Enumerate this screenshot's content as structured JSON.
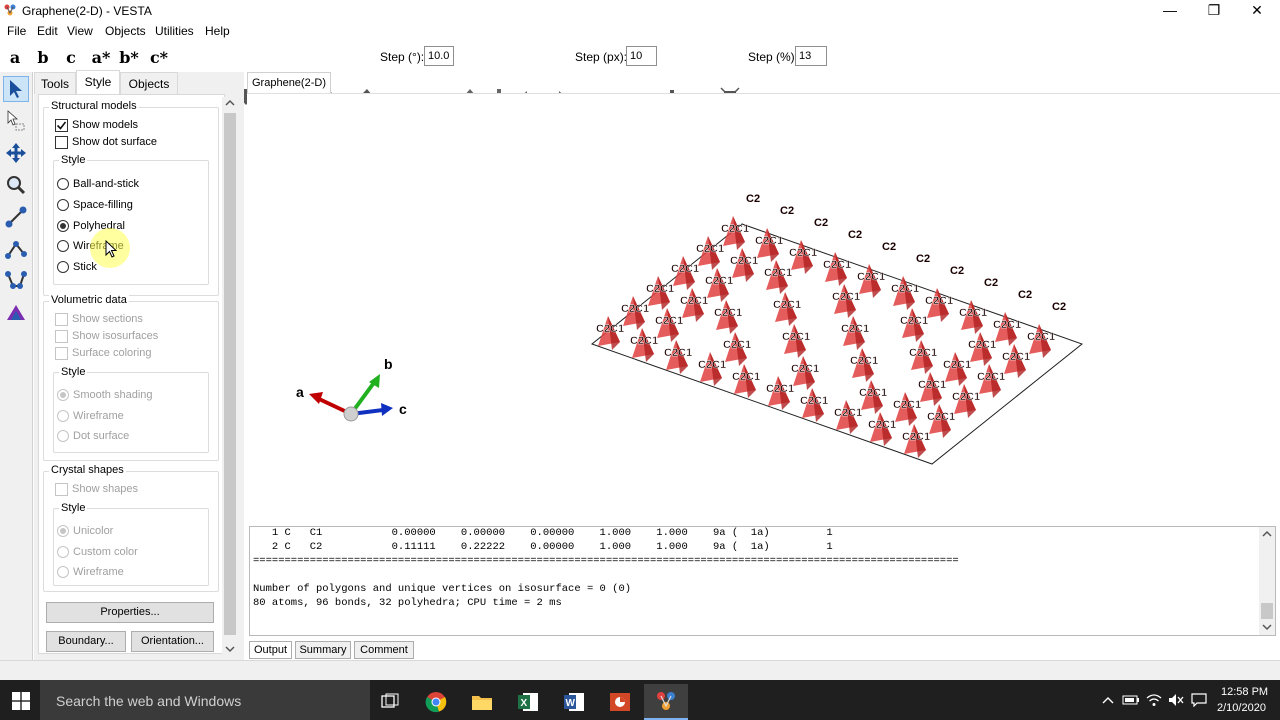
{
  "window": {
    "title": "Graphene(2-D) - VESTA",
    "minimize": "—",
    "restore": "❐",
    "close": "✕"
  },
  "menu": [
    "File",
    "Edit",
    "View",
    "Objects",
    "Utilities",
    "Help"
  ],
  "toolbar": {
    "axis_buttons": [
      "a",
      "b",
      "c",
      "a*",
      "b*",
      "c*"
    ],
    "step_deg_label": "Step (°):",
    "step_deg_value": "10.0",
    "step_px_label": "Step (px):",
    "step_px_value": "10",
    "step_pct_label": "Step (%):",
    "step_pct_value": "13"
  },
  "panel": {
    "tabs": [
      "Tools",
      "Style",
      "Objects"
    ],
    "structural": {
      "title": "Structural models",
      "show_models": "Show models",
      "show_dot_surface": "Show dot surface",
      "style_title": "Style",
      "styles": [
        "Ball-and-stick",
        "Space-filling",
        "Polyhedral",
        "Wireframe",
        "Stick"
      ],
      "selected": "Polyhedral"
    },
    "volumetric": {
      "title": "Volumetric data",
      "options": [
        "Show sections",
        "Show isosurfaces",
        "Surface coloring"
      ],
      "style_title": "Style",
      "styles": [
        "Smooth shading",
        "Wireframe",
        "Dot surface"
      ]
    },
    "crystal": {
      "title": "Crystal shapes",
      "show_shapes": "Show shapes",
      "style_title": "Style",
      "styles": [
        "Unicolor",
        "Custom color",
        "Wireframe"
      ]
    },
    "buttons": {
      "properties": "Properties...",
      "boundary": "Boundary...",
      "orientation": "Orientation..."
    }
  },
  "view_tab": "Graphene(2-D)",
  "axes": {
    "a": "a",
    "b": "b",
    "c": "c"
  },
  "atom_labels": {
    "c1": "C1",
    "c2": "C2"
  },
  "output": {
    "lines": [
      "   1 C   C1           0.00000    0.00000    0.00000    1.000    1.000    9a (  1a)         1",
      "   2 C   C2           0.11111    0.22222    0.00000    1.000    1.000    9a (  1a)         1",
      "================================================================================================================",
      "",
      "Number of polygons and unique vertices on isosurface = 0 (0)",
      "80 atoms, 96 bonds, 32 polyhedra; CPU time = 2 ms"
    ],
    "tabs": [
      "Output",
      "Summary",
      "Comment"
    ]
  },
  "taskbar": {
    "search_placeholder": "Search the web and Windows",
    "time": "12:58 PM",
    "date": "2/10/2020"
  },
  "colors": {
    "polyhedra": "#e0403f",
    "accent": "#0078d7",
    "cursor_highlight": "#ffff66"
  }
}
